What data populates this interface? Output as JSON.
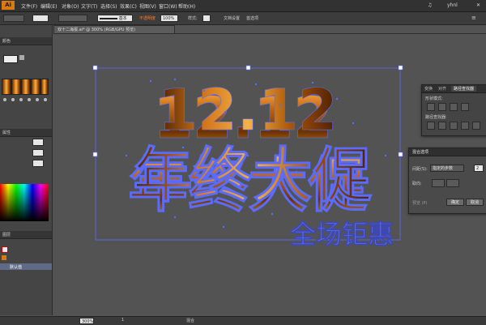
{
  "app": {
    "logo": "Ai"
  },
  "menu": {
    "items": [
      "文件(F)",
      "编辑(E)",
      "对象(O)",
      "文字(T)",
      "选择(S)",
      "效果(C)",
      "视图(V)",
      "窗口(W)",
      "帮助(H)"
    ],
    "user": "yhnl"
  },
  "control": {
    "stroke_label": "基本",
    "opacity_warning": "不透明度",
    "opacity_value": "100%",
    "style_label": "样式:",
    "doc_setup": "文档设置",
    "prefs": "首选项"
  },
  "document": {
    "tab_title": "双十二海报.ai* @ 300% (RGB/GPU 预览)"
  },
  "left_panel": {
    "tab1": "颜色",
    "tab2": "属性",
    "layers_tab": "图层",
    "layer_label": "默认值",
    "swatch_count": 5
  },
  "artwork": {
    "line1": "12.12",
    "line2": "年终大促",
    "line3": "全场钜惠"
  },
  "pathfinder_panel": {
    "tabs": [
      "变换",
      "对齐",
      "路径查找器"
    ],
    "shape_modes_label": "形状模式:",
    "pathfinders_label": "路径查找器:"
  },
  "blend_dialog": {
    "title": "混合选项",
    "spacing_label": "间距(S):",
    "spacing_value": "指定的步数",
    "steps_value": "2",
    "orientation_label": "取向:",
    "preview_label": "预览 (P)",
    "ok": "确定",
    "cancel": "取消"
  },
  "status": {
    "zoom": "300%",
    "page": "1",
    "mode": "混合"
  },
  "colors": {
    "accent": "#d97a0f",
    "gold_dark": "#5a2b00",
    "gold_light": "#f3b04e",
    "selection": "#5a6cff"
  }
}
